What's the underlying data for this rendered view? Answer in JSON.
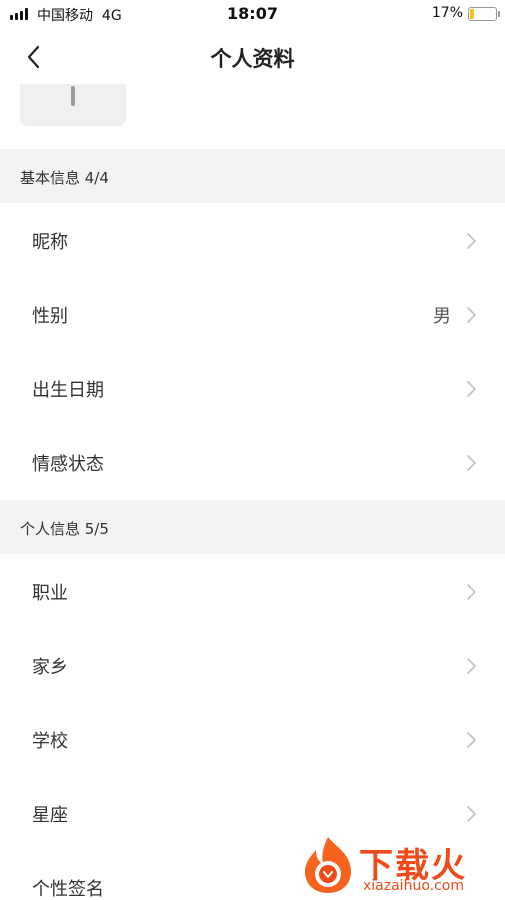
{
  "status_bar": {
    "carrier": "中国移动",
    "network": "4G",
    "time": "18:07",
    "battery_percent_label": "17%",
    "battery_level": 0.17,
    "battery_color": "#f0c419"
  },
  "nav": {
    "back_icon": "chevron-left-icon",
    "title": "个人资料"
  },
  "sections": {
    "basic": {
      "header": "基本信息 4/4",
      "rows": [
        {
          "label": "昵称",
          "value": ""
        },
        {
          "label": "性别",
          "value": "男"
        },
        {
          "label": "出生日期",
          "value": ""
        },
        {
          "label": "情感状态",
          "value": ""
        }
      ]
    },
    "personal": {
      "header": "个人信息 5/5",
      "rows": [
        {
          "label": "职业",
          "value": ""
        },
        {
          "label": "家乡",
          "value": ""
        },
        {
          "label": "学校",
          "value": ""
        },
        {
          "label": "星座",
          "value": ""
        },
        {
          "label": "个性签名",
          "value": ""
        }
      ]
    }
  },
  "watermark": {
    "brand": "下载火",
    "site": "xiazaihuo.com",
    "color": "#f04a1a"
  }
}
